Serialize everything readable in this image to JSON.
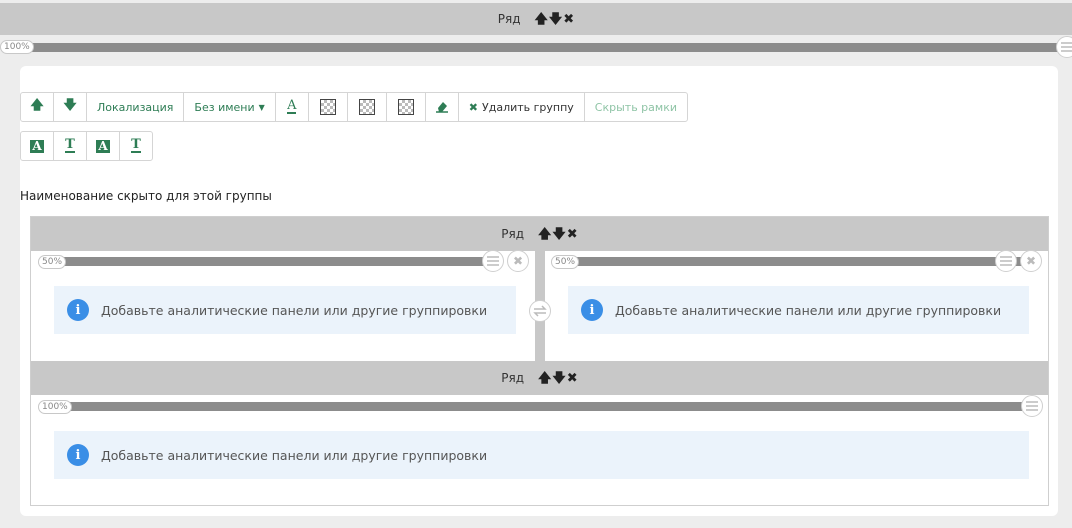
{
  "top_row": {
    "label": "Ряд",
    "width_pct": "100%"
  },
  "toolbar": {
    "localization": "Локализация",
    "unnamed": "Без имени",
    "delete_group": "Удалить группу",
    "hide_borders": "Скрыть рамки"
  },
  "caption": "Наименование скрыто для этой группы",
  "inner_row_1": {
    "label": "Ряд",
    "left_pct": "50%",
    "right_pct": "50%",
    "left_notice": "Добавьте аналитические панели или другие группировки",
    "right_notice": "Добавьте аналитические панели или другие группировки"
  },
  "inner_row_2": {
    "label": "Ряд",
    "width_pct": "100%",
    "notice": "Добавьте аналитические панели или другие группировки"
  },
  "colors": {
    "accent": "#2e7d55",
    "info": "#3a8ee6",
    "bar": "#c8c8c8"
  }
}
